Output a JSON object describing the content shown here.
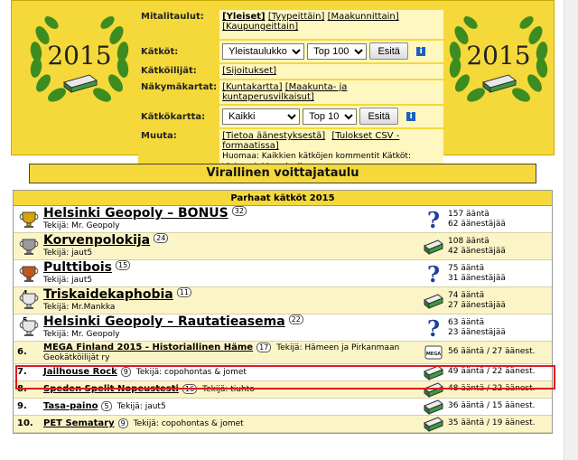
{
  "menu": {
    "mitalitaulut_label": "Mitalitaulut:",
    "mitalitaulut_links": [
      "[Yleiset]",
      "[Tyypeittäin]",
      "[Maakunnittain]",
      "[Kaupungeittain]"
    ],
    "katkot_label": "Kätköt:",
    "katkot_select": "Yleistaulukko",
    "katkot_top": "Top 100",
    "esita": "Esitä",
    "katkoilijat_label": "Kätköilijät:",
    "katkoilijat_link": "[Sijoitukset]",
    "nakymakartat_label": "Näkymäkartat:",
    "nakymakartat_links": [
      "[Kuntakartta]",
      "[Maakunta- ja kuntaperusvilkaisut]"
    ],
    "katkokartta_label": "Kätkökartta:",
    "katkokartta_select": "Kaikki",
    "katkokartta_top": "Top 10",
    "muuta_label": "Muuta:",
    "muuta_links": [
      "[Tietoa äänestyksestä]",
      "[Tulokset CSV -formaatissa]"
    ],
    "muuta_note": "Huomaa: Kaikkien kätköjen kommentit Kätköt: Yleistaulukko -sivulla"
  },
  "header": {
    "year": "2015"
  },
  "banner": "Virallinen voittajataulu",
  "list": {
    "title": "Parhaat kätköt 2015",
    "rows": [
      {
        "rank": "",
        "name": "Helsinki Geopoly – BONUS",
        "count": "32",
        "maker": "Tekijä: Mr. Geopoly",
        "votes": "157 ääntä",
        "voters": "62 äänestäjää",
        "icon": "question-mark-icon",
        "medal": "gold"
      },
      {
        "rank": "",
        "name": "Korvenpolokija",
        "count": "24",
        "maker": "Tekijä: jaut5",
        "votes": "108 ääntä",
        "voters": "42 äänestäjää",
        "icon": "traditional-cache-icon",
        "medal": "silver"
      },
      {
        "rank": "",
        "name": "Pulttibois",
        "count": "15",
        "maker": "Tekijä: jaut5",
        "votes": "75 ääntä",
        "voters": "31 äänestäjää",
        "icon": "question-mark-icon",
        "medal": "bronze"
      },
      {
        "rank": "4.",
        "name": "Triskaidekaphobia",
        "count": "11",
        "maker": "Tekijä: Mr.Mankka",
        "votes": "74 ääntä",
        "voters": "27 äänestäjää",
        "icon": "traditional-cache-icon",
        "medal": "plain"
      },
      {
        "rank": "5.",
        "name": "Helsinki Geopoly – Rautatieasema",
        "count": "22",
        "maker": "Tekijä: Mr. Geopoly",
        "votes": "63 ääntä",
        "voters": "23 äänestäjää",
        "icon": "question-mark-icon",
        "medal": "plain"
      },
      {
        "rank": "6.",
        "name": "MEGA Finland 2015 - Historiallinen Häme",
        "count": "17",
        "maker": "Tekijä: Hämeen ja Pirkanmaan",
        "maker2": "Geokätköilijät ry",
        "votes": "56 ääntä / 27 äänest.",
        "icon": "mega-event-icon"
      },
      {
        "rank": "7.",
        "name": "Jailhouse Rock",
        "count": "9",
        "maker": "Tekijä: copohontas & jomet",
        "votes": "49 ääntä / 22 äänest.",
        "icon": "traditional-cache-icon"
      },
      {
        "rank": "8.",
        "name": "Speden Spelit Nopeustesti",
        "count": "16",
        "maker": "Tekijä: tiuhto",
        "votes": "48 ääntä / 22 äänest.",
        "icon": "traditional-cache-icon"
      },
      {
        "rank": "9.",
        "name": "Tasa-paino",
        "count": "5",
        "maker": "Tekijä: jaut5",
        "votes": "36 ääntä / 15 äänest.",
        "icon": "traditional-cache-icon"
      },
      {
        "rank": "10.",
        "name": "PET Sematary",
        "count": "9",
        "maker": "Tekijä: copohontas & jomet",
        "votes": "35 ääntä / 19 äänest.",
        "icon": "traditional-cache-icon"
      }
    ]
  },
  "colors": {
    "header_yellow": "#f5d93a",
    "row_alt": "#fbf4c7",
    "highlight": "#e01b1b",
    "icon_blue": "#1d5fbf",
    "cache_green": "#2f7a2f"
  }
}
